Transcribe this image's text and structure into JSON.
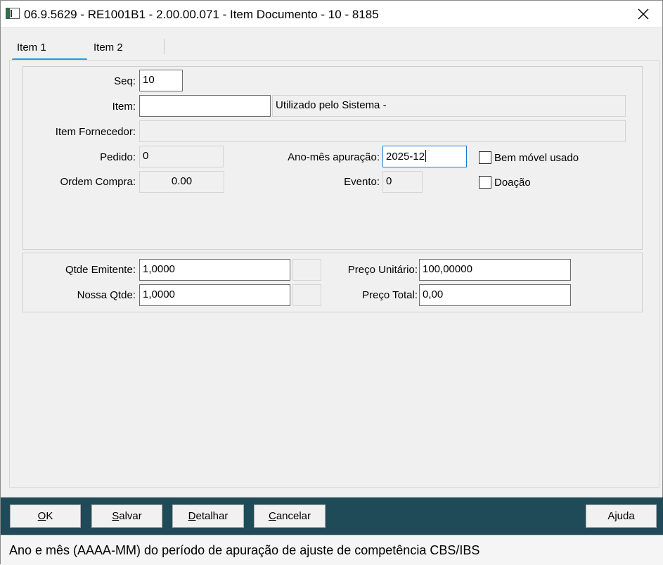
{
  "window": {
    "title": "06.9.5629 - RE1001B1 - 2.00.00.071 - Item Documento - 10 - 8185",
    "app_icon": "window-app-icon",
    "close_icon": "close-icon"
  },
  "tabs": [
    {
      "label": "Item 1",
      "active": true
    },
    {
      "label": "Item 2",
      "active": false
    }
  ],
  "form": {
    "seq": {
      "label": "Seq:",
      "value": "10"
    },
    "item": {
      "label": "Item:",
      "value": "",
      "description": "Utilizado pelo Sistema -"
    },
    "item_fornecedor": {
      "label": "Item Fornecedor:",
      "value": ""
    },
    "pedido": {
      "label": "Pedido:",
      "value": "0"
    },
    "ordem_compra": {
      "label": "Ordem Compra:",
      "value": "0.00"
    },
    "ano_mes_apuracao": {
      "label": "Ano-mês apuração:",
      "value": "2025-12"
    },
    "evento": {
      "label": "Evento:",
      "value": "0"
    },
    "bem_movel_usado": {
      "label": "Bem móvel usado",
      "checked": false
    },
    "doacao": {
      "label": "Doação",
      "checked": false
    },
    "qtde_emitente": {
      "label": "Qtde Emitente:",
      "value": "1,0000",
      "unit": ""
    },
    "nossa_qtde": {
      "label": "Nossa Qtde:",
      "value": "1,0000",
      "unit": ""
    },
    "preco_unitario": {
      "label": "Preço Unitário:",
      "value": "100,00000"
    },
    "preco_total": {
      "label": "Preço Total:",
      "value": "0,00"
    }
  },
  "buttons": {
    "ok": {
      "underline": "O",
      "rest": "K"
    },
    "salvar": {
      "underline": "S",
      "rest": "alvar"
    },
    "detalhar": {
      "underline": "D",
      "rest": "etalhar"
    },
    "cancelar": {
      "underline": "C",
      "rest": "ancelar"
    },
    "ajuda": "Ajuda"
  },
  "status": {
    "text": "Ano e mês (AAAA-MM) do período de apuração de ajuste de competência CBS/IBS"
  },
  "colors": {
    "button_bar": "#1f4a57",
    "tab_accent": "#1aa3e0",
    "focus_border": "#1a7ad6"
  }
}
